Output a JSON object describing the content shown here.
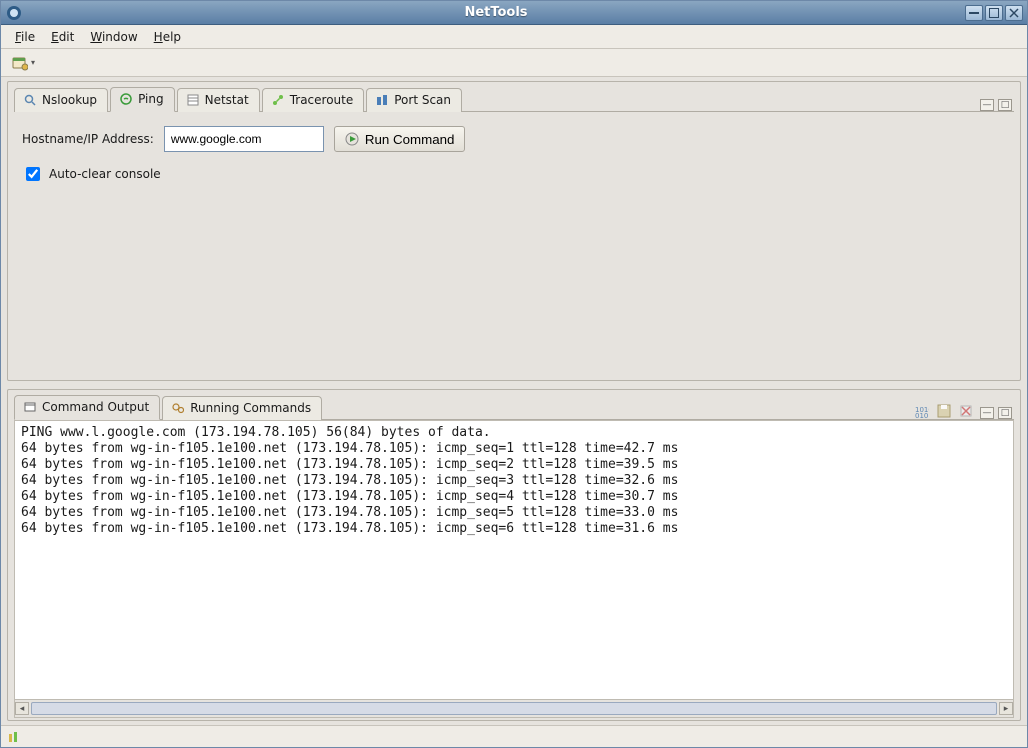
{
  "titlebar": {
    "title": "NetTools"
  },
  "menus": {
    "file": "File",
    "edit": "Edit",
    "window": "Window",
    "help": "Help"
  },
  "tabs_top": {
    "nslookup": "Nslookup",
    "ping": "Ping",
    "netstat": "Netstat",
    "traceroute": "Traceroute",
    "portscan": "Port Scan",
    "active": "ping"
  },
  "ping_form": {
    "host_label": "Hostname/IP Address:",
    "host_value": "www.google.com",
    "run_label": "Run Command",
    "autoclear_label": "Auto-clear console",
    "autoclear_checked": true
  },
  "tabs_bottom": {
    "output": "Command Output",
    "running": "Running Commands",
    "active": "output"
  },
  "console_lines": [
    "PING www.l.google.com (173.194.78.105) 56(84) bytes of data.",
    "64 bytes from wg-in-f105.1e100.net (173.194.78.105): icmp_seq=1 ttl=128 time=42.7 ms",
    "64 bytes from wg-in-f105.1e100.net (173.194.78.105): icmp_seq=2 ttl=128 time=39.5 ms",
    "64 bytes from wg-in-f105.1e100.net (173.194.78.105): icmp_seq=3 ttl=128 time=32.6 ms",
    "64 bytes from wg-in-f105.1e100.net (173.194.78.105): icmp_seq=4 ttl=128 time=30.7 ms",
    "64 bytes from wg-in-f105.1e100.net (173.194.78.105): icmp_seq=5 ttl=128 time=33.0 ms",
    "64 bytes from wg-in-f105.1e100.net (173.194.78.105): icmp_seq=6 ttl=128 time=31.6 ms"
  ]
}
